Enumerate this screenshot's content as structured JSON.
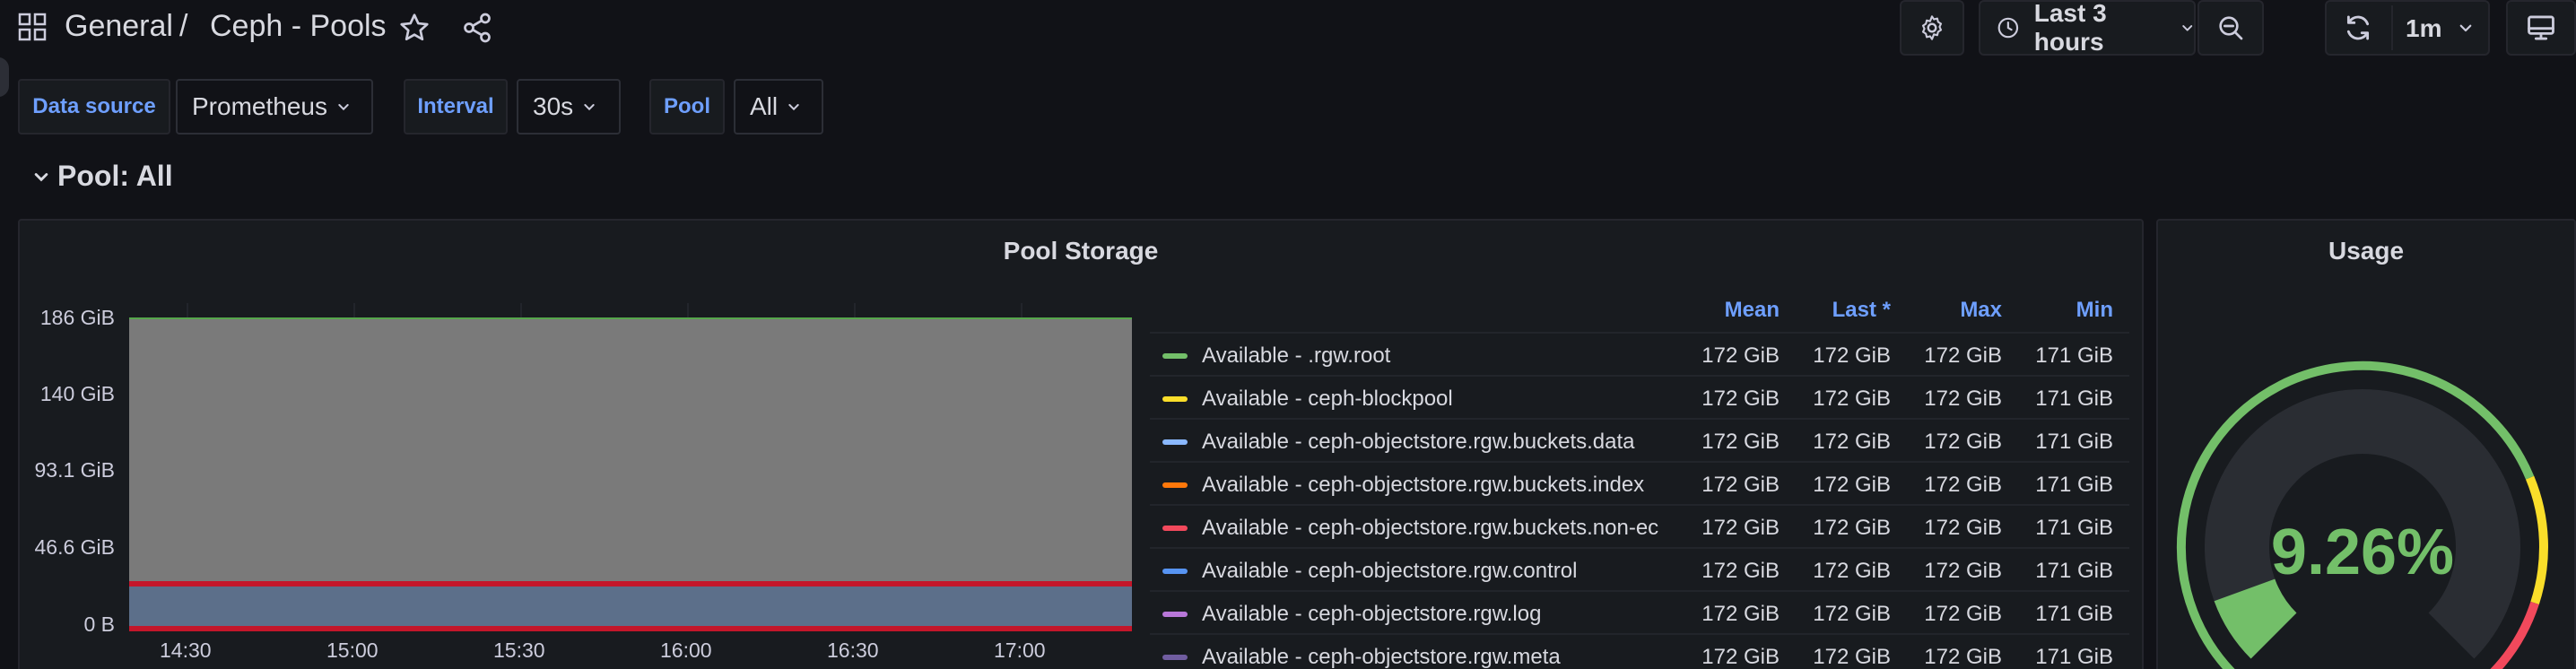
{
  "header": {
    "breadcrumb_folder": "General",
    "breadcrumb_separator": "/",
    "dashboard_title": "Ceph - Pools",
    "time_range": "Last 3 hours",
    "refresh_interval": "1m",
    "icons": [
      "apps-icon",
      "star-icon",
      "share-icon",
      "gear-icon",
      "clock-icon",
      "chevron-down-icon",
      "zoom-out-icon",
      "refresh-icon",
      "tv-icon"
    ]
  },
  "variables": [
    {
      "label": "Data source",
      "value": "Prometheus"
    },
    {
      "label": "Interval",
      "value": "30s"
    },
    {
      "label": "Pool",
      "value": "All"
    }
  ],
  "row": {
    "title": "Pool: All"
  },
  "pool_storage": {
    "title": "Pool Storage",
    "y_ticks": [
      "186 GiB",
      "140 GiB",
      "93.1 GiB",
      "46.6 GiB",
      "0 B"
    ],
    "x_ticks": [
      "14:30",
      "15:00",
      "15:30",
      "16:00",
      "16:30",
      "17:00"
    ],
    "legend_headers": [
      "Mean",
      "Last *",
      "Max",
      "Min"
    ],
    "legend": [
      {
        "name": "Available - .rgw.root",
        "color": "#73bf69",
        "mean": "172 GiB",
        "last": "172 GiB",
        "max": "172 GiB",
        "min": "171 GiB"
      },
      {
        "name": "Available - ceph-blockpool",
        "color": "#fade2a",
        "mean": "172 GiB",
        "last": "172 GiB",
        "max": "172 GiB",
        "min": "171 GiB"
      },
      {
        "name": "Available - ceph-objectstore.rgw.buckets.data",
        "color": "#8ab8ff",
        "mean": "172 GiB",
        "last": "172 GiB",
        "max": "172 GiB",
        "min": "171 GiB"
      },
      {
        "name": "Available - ceph-objectstore.rgw.buckets.index",
        "color": "#ff780a",
        "mean": "172 GiB",
        "last": "172 GiB",
        "max": "172 GiB",
        "min": "171 GiB"
      },
      {
        "name": "Available - ceph-objectstore.rgw.buckets.non-ec",
        "color": "#f2495c",
        "mean": "172 GiB",
        "last": "172 GiB",
        "max": "172 GiB",
        "min": "171 GiB"
      },
      {
        "name": "Available - ceph-objectstore.rgw.control",
        "color": "#5794f2",
        "mean": "172 GiB",
        "last": "172 GiB",
        "max": "172 GiB",
        "min": "171 GiB"
      },
      {
        "name": "Available - ceph-objectstore.rgw.log",
        "color": "#b877d9",
        "mean": "172 GiB",
        "last": "172 GiB",
        "max": "172 GiB",
        "min": "171 GiB"
      },
      {
        "name": "Available - ceph-objectstore.rgw.meta",
        "color": "#705da0",
        "mean": "172 GiB",
        "last": "172 GiB",
        "max": "172 GiB",
        "min": "171 GiB"
      }
    ]
  },
  "chart_data": {
    "type": "area",
    "title": "Pool Storage",
    "x": [
      "14:15",
      "17:15"
    ],
    "ylim": [
      0,
      186
    ],
    "y_unit": "GiB",
    "stacked_layers": [
      {
        "label": "used",
        "values": [
          31,
          31
        ],
        "color": "#5c6f8a"
      },
      {
        "label": "available",
        "values": [
          172,
          172
        ],
        "color": "#7a7a7a"
      }
    ],
    "threshold_line": {
      "value": 31,
      "color": "#c4162a"
    },
    "baseline_line": {
      "value": 0,
      "color": "#c4162a"
    }
  },
  "usage": {
    "title": "Usage",
    "value_text": "9.26%",
    "value": 9.26,
    "thresholds": [
      {
        "color": "#73bf69",
        "upto": 75
      },
      {
        "color": "#fade2a",
        "upto": 90
      },
      {
        "color": "#f2495c",
        "upto": 100
      }
    ]
  }
}
